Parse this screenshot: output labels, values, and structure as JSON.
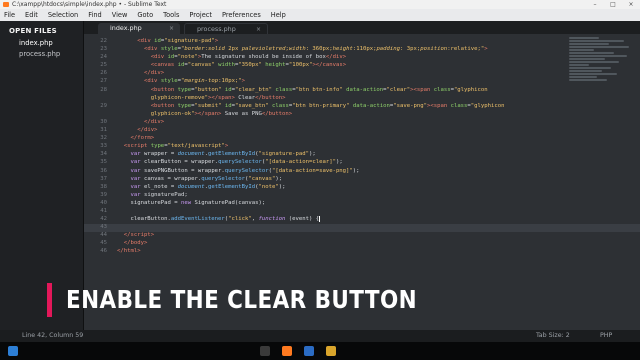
{
  "window": {
    "title": "C:\\xampp\\htdocs\\simple\\index.php • - Sublime Text",
    "controls": [
      "–",
      "□",
      "×"
    ]
  },
  "menu": [
    "File",
    "Edit",
    "Selection",
    "Find",
    "View",
    "Goto",
    "Tools",
    "Project",
    "Preferences",
    "Help"
  ],
  "sidebar": {
    "header": "OPEN FILES",
    "files": [
      "index.php",
      "process.php"
    ]
  },
  "tabs": [
    {
      "label": "index.php",
      "close": "×"
    },
    {
      "label": "process.php",
      "close": "×"
    }
  ],
  "editor": {
    "line_numbers": [
      "22",
      "23",
      "24",
      "25",
      "26",
      "27",
      "28",
      "29",
      "30",
      "31",
      "32",
      "33",
      "34",
      "35",
      "36",
      "37",
      "38",
      "39",
      "40",
      "41",
      "42",
      "43",
      "44",
      "45",
      "46"
    ],
    "current_line": "42"
  },
  "caption": "ENABLE THE CLEAR BUTTON",
  "status": {
    "position": "Line 42, Column 59",
    "tab_size": "Tab Size: 2",
    "syntax": "PHP"
  },
  "colors": {
    "accent_bar": "#e3185a",
    "editor_bg": "#2d3034"
  }
}
